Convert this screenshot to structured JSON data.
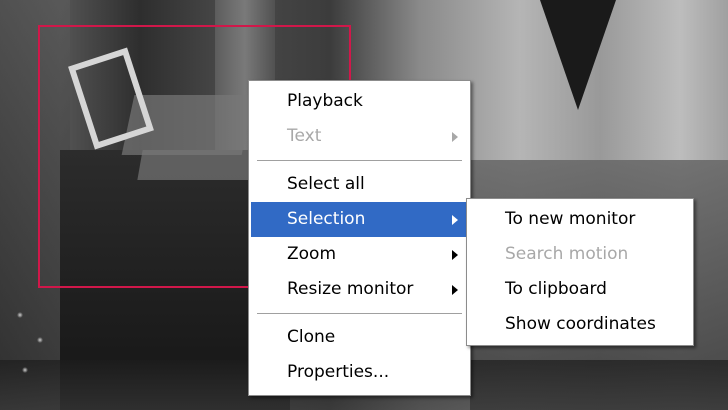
{
  "main_menu": {
    "groups": [
      [
        {
          "label": "Playback",
          "enabled": true
        },
        {
          "label": "Text",
          "enabled": false,
          "submenu": true
        }
      ],
      [
        {
          "label": "Select all",
          "enabled": true
        },
        {
          "label": "Selection",
          "enabled": true,
          "submenu": true,
          "active": true
        },
        {
          "label": "Zoom",
          "enabled": true,
          "submenu": true
        },
        {
          "label": "Resize monitor",
          "enabled": true,
          "submenu": true
        }
      ],
      [
        {
          "label": "Clone",
          "enabled": true
        },
        {
          "label": "Properties...",
          "enabled": true
        }
      ]
    ]
  },
  "selection_submenu": {
    "items": [
      {
        "label": "To new monitor",
        "enabled": true
      },
      {
        "label": "Search motion",
        "enabled": false
      },
      {
        "label": "To clipboard",
        "enabled": true
      },
      {
        "label": "Show coordinates",
        "enabled": true
      }
    ]
  },
  "colors": {
    "highlight": "#316ac5",
    "selection_rect": "#d1174a",
    "disabled_text": "#a8a8a8"
  }
}
